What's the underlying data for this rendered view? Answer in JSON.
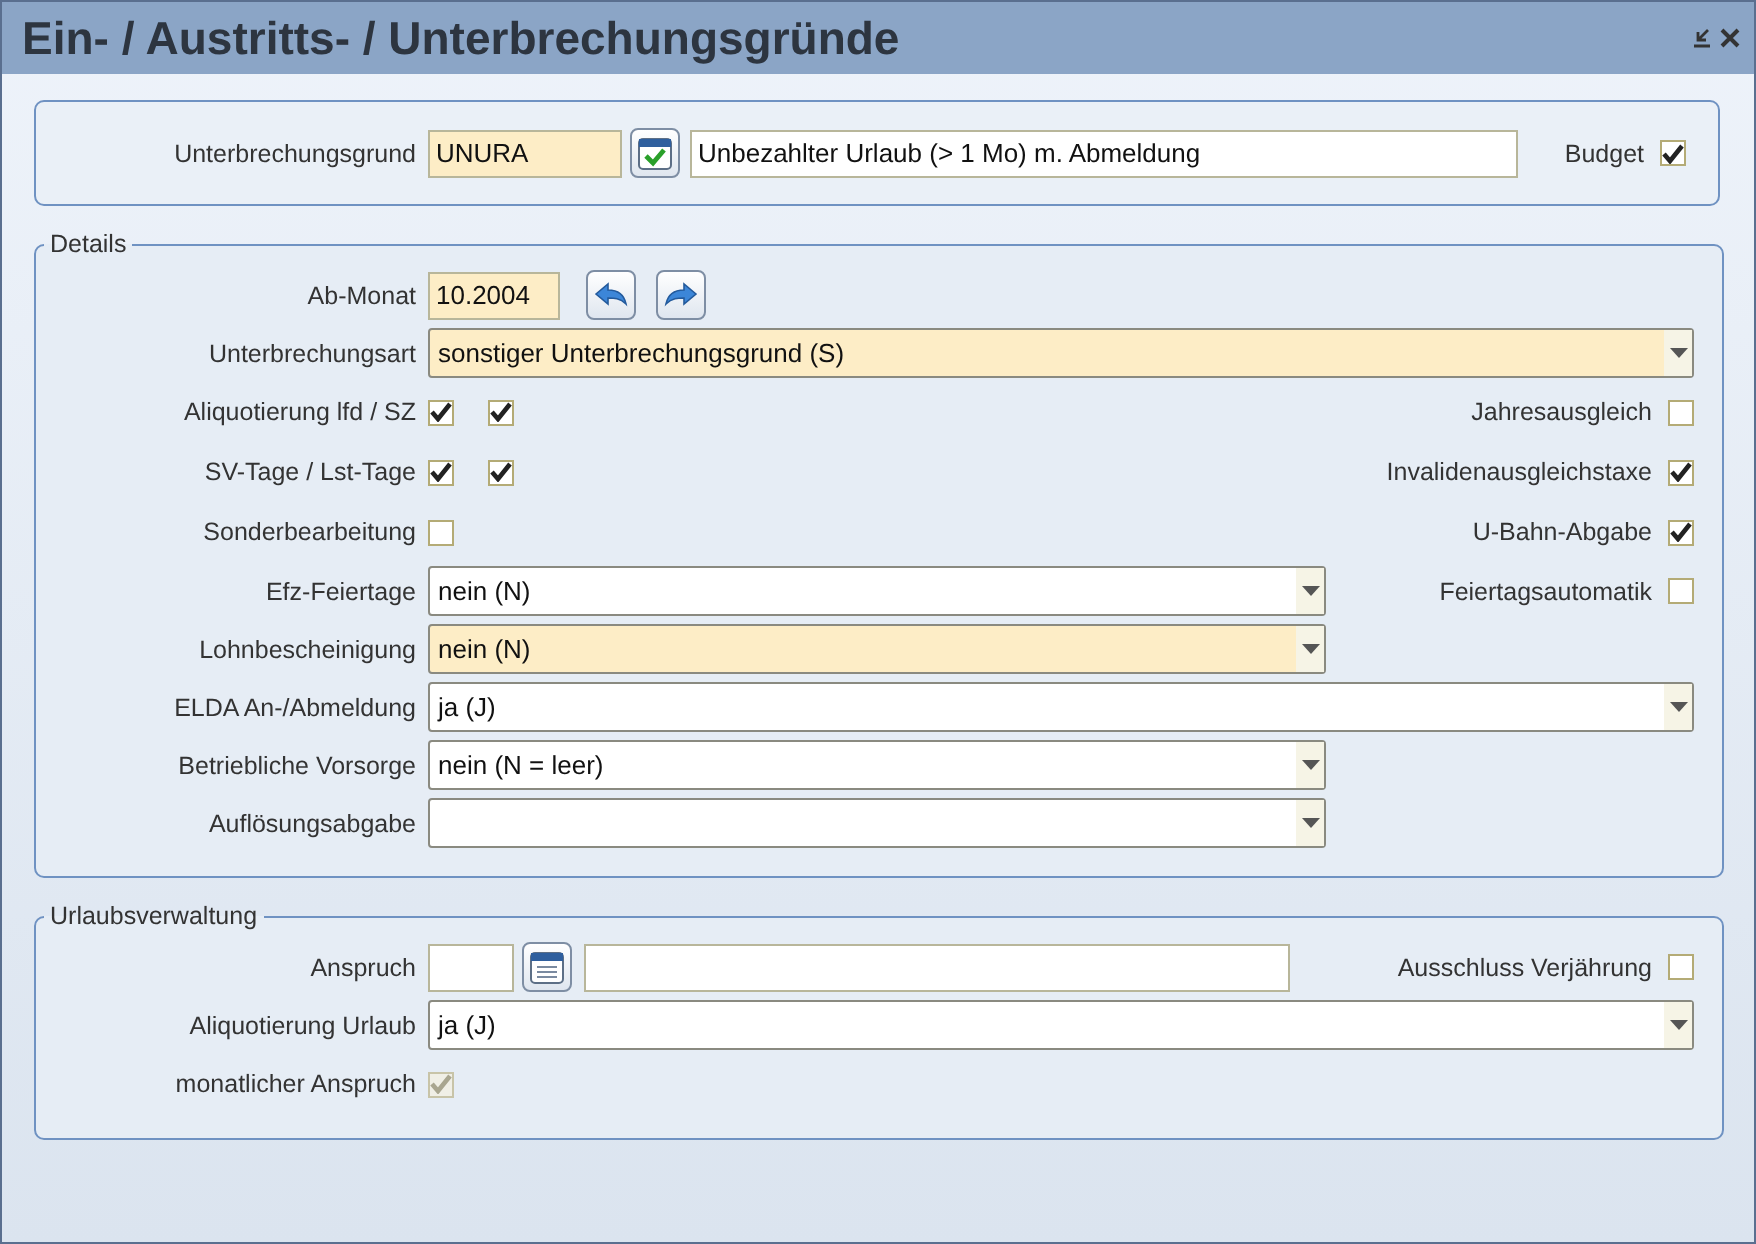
{
  "window": {
    "title": "Ein- / Austritts- / Unterbrechungsgründe"
  },
  "header": {
    "label": "Unterbrechungsgrund",
    "code": "UNURA",
    "description": "Unbezahlter Urlaub (> 1 Mo) m. Abmeldung",
    "side": {
      "label": "Budget",
      "checked": true
    }
  },
  "details": {
    "legend": "Details",
    "rows": [
      {
        "kind": "month",
        "label": "Ab-Monat",
        "value": "10.2004"
      },
      {
        "kind": "select",
        "label": "Unterbrechungsart",
        "value": "sonstiger Unterbrechungsgrund (S)",
        "highlighted": true,
        "wide": true
      },
      {
        "kind": "checks",
        "label": "Aliquotierung lfd / SZ",
        "boxes": [
          {
            "checked": true
          },
          {
            "checked": true
          }
        ],
        "side": {
          "label": "Jahresausgleich",
          "checked": false
        }
      },
      {
        "kind": "checks",
        "label": "SV-Tage / Lst-Tage",
        "boxes": [
          {
            "checked": true
          },
          {
            "checked": true
          }
        ],
        "side": {
          "label": "Invalidenausgleichstaxe",
          "checked": true
        }
      },
      {
        "kind": "checks",
        "label": "Sonderbearbeitung",
        "boxes": [
          {
            "checked": false
          }
        ],
        "side": {
          "label": "U-Bahn-Abgabe",
          "checked": true
        }
      },
      {
        "kind": "select",
        "label": "Efz-Feiertage",
        "value": "nein (N)",
        "highlighted": false,
        "wide": false,
        "side": {
          "label": "Feiertagsautomatik",
          "checked": false
        }
      },
      {
        "kind": "select",
        "label": "Lohnbescheinigung",
        "value": "nein (N)",
        "highlighted": true,
        "wide": false
      },
      {
        "kind": "select",
        "label": "ELDA An-/Abmeldung",
        "value": "ja (J)",
        "highlighted": false,
        "wide": true
      },
      {
        "kind": "select",
        "label": "Betriebliche Vorsorge",
        "value": "nein (N = leer)",
        "highlighted": false,
        "wide": false
      },
      {
        "kind": "select",
        "label": "Auflösungsabgabe",
        "highlighted": false,
        "wide": false
      }
    ]
  },
  "vacation": {
    "legend": "Urlaubsverwaltung",
    "rows": [
      {
        "kind": "amount",
        "label": "Anspruch",
        "side": {
          "label": "Ausschluss Verjährung",
          "checked": false
        }
      },
      {
        "kind": "select",
        "label": "Aliquotierung Urlaub",
        "value": "ja (J)",
        "highlighted": false,
        "wide": true
      },
      {
        "kind": "checks",
        "label": "monatlicher Anspruch",
        "boxes": [
          {
            "checked": true,
            "disabled": true
          }
        ]
      }
    ]
  }
}
